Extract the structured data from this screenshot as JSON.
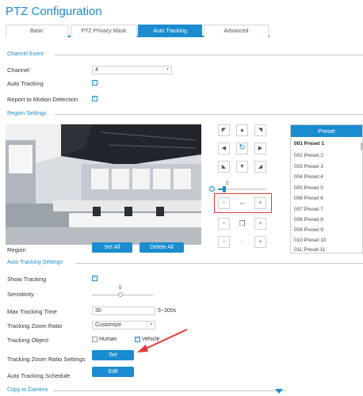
{
  "title": "PTZ Configuration",
  "tabs": [
    {
      "label": "Basic"
    },
    {
      "label": "PTZ Privacy Mask"
    },
    {
      "label": "Auto Tracking"
    },
    {
      "label": "Advanced"
    }
  ],
  "channel_event": {
    "header": "Channel Event",
    "channel_label": "Channel",
    "channel_value": "4",
    "auto_tracking_label": "Auto Tracking",
    "report_label": "Report to Motion Detection"
  },
  "region_settings": {
    "header": "Region Settings",
    "region_label": "Region",
    "set_all": "Set All",
    "delete_all": "Delete All",
    "speed_value": "2"
  },
  "preset": {
    "header": "Preset",
    "items": [
      {
        "num": "001",
        "name": "Preset 1"
      },
      {
        "num": "002",
        "name": "Preset 2"
      },
      {
        "num": "003",
        "name": "Preset 3"
      },
      {
        "num": "004",
        "name": "Preset 4"
      },
      {
        "num": "005",
        "name": "Preset 5"
      },
      {
        "num": "006",
        "name": "Preset 6"
      },
      {
        "num": "007",
        "name": "Preset 7"
      },
      {
        "num": "008",
        "name": "Preset 8"
      },
      {
        "num": "009",
        "name": "Preset 9"
      },
      {
        "num": "010",
        "name": "Preset 10"
      },
      {
        "num": "011",
        "name": "Preset 11"
      }
    ]
  },
  "auto_tracking_settings": {
    "header": "Auto Tracking Settings",
    "show_tracking_label": "Show Tracking",
    "sensitivity_label": "Sensitivity",
    "sensitivity_value": "5",
    "max_time_label": "Max Tracking Time",
    "max_time_value": "30",
    "max_time_range": "5~300s",
    "zoom_ratio_label": "Tracking Zoom Ratio",
    "zoom_ratio_value": "Customize",
    "object_label": "Tracking Object",
    "object_human": "Human",
    "object_vehicle": "Vehicle",
    "zoom_settings_label": "Tracking Zoom Ratio Settings",
    "set_button": "Set",
    "schedule_label": "Auto Tracking Schedule",
    "edit_button": "Edit"
  },
  "copy_to_camera": {
    "header": "Copy to Camera"
  },
  "colors": {
    "accent": "#1a8ccf",
    "highlight": "#e53935"
  }
}
